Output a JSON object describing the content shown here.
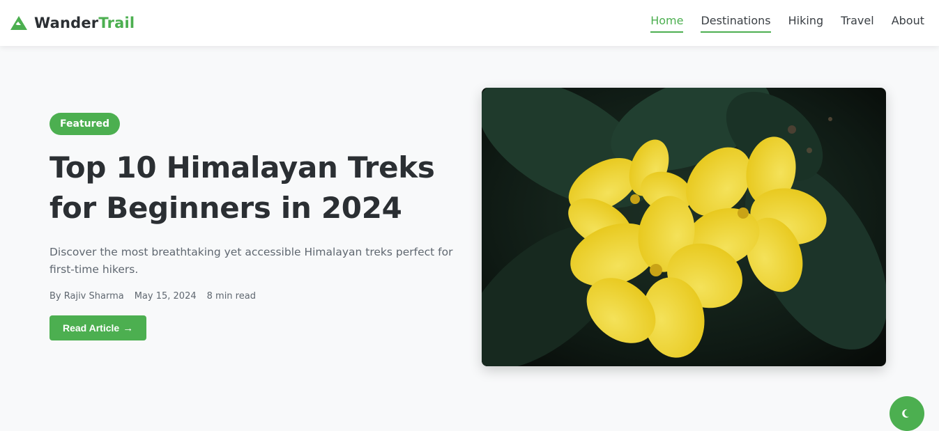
{
  "brand": {
    "name_part1": "Wander",
    "name_part2": "Trail",
    "icon": "mountain-icon"
  },
  "nav": {
    "items": [
      {
        "label": "Home",
        "active": true
      },
      {
        "label": "Destinations",
        "active": false
      },
      {
        "label": "Hiking",
        "active": false
      },
      {
        "label": "Travel",
        "active": false
      },
      {
        "label": "About",
        "active": false
      }
    ]
  },
  "hero": {
    "badge": "Featured",
    "title": "Top 10 Himalayan Treks for Beginners in 2024",
    "description": "Discover the most breathtaking yet accessible Himalayan treks perfect for first-time hikers.",
    "author": "By Rajiv Sharma",
    "date": "May 15, 2024",
    "read_time": "8 min read",
    "cta_label": "Read Article",
    "image": "yellow-flowers-photo"
  },
  "theme_toggle": {
    "icon": "moon-icon"
  },
  "colors": {
    "accent": "#4caf50",
    "text": "#2b2f33",
    "muted": "#5f6770",
    "background": "#f8f9fa"
  }
}
